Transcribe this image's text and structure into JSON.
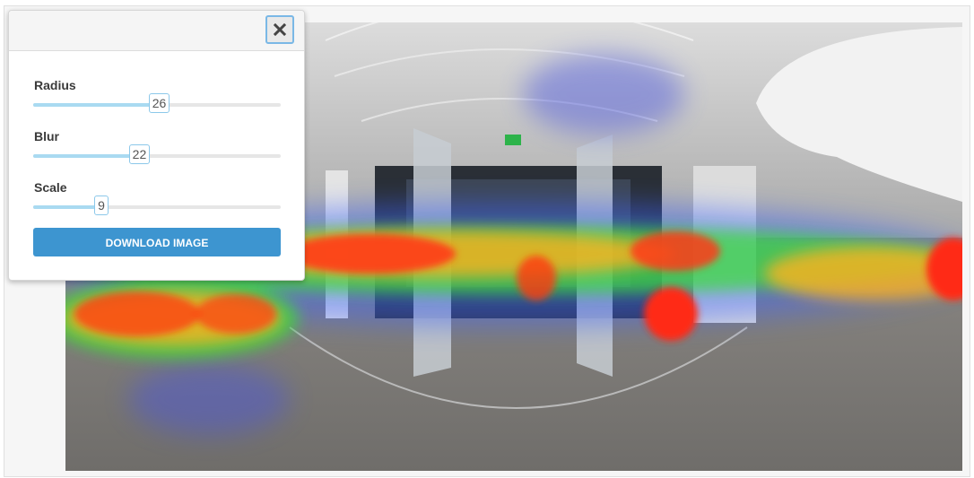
{
  "panel": {
    "close_icon": "close-icon",
    "sliders": [
      {
        "label": "Radius",
        "value": "26",
        "fraction": 0.51
      },
      {
        "label": "Blur",
        "value": "22",
        "fraction": 0.43
      },
      {
        "label": "Scale",
        "value": "9",
        "fraction": 0.29
      }
    ],
    "download_label": "DOWNLOAD IMAGE"
  },
  "colors": {
    "accent": "#3d95d0",
    "slider_fill": "#a9daf1",
    "heat_hot": "#ff2a12",
    "heat_warm": "#ffb21a",
    "heat_mid": "#3cdc3c",
    "heat_cool": "#3c64ff"
  }
}
